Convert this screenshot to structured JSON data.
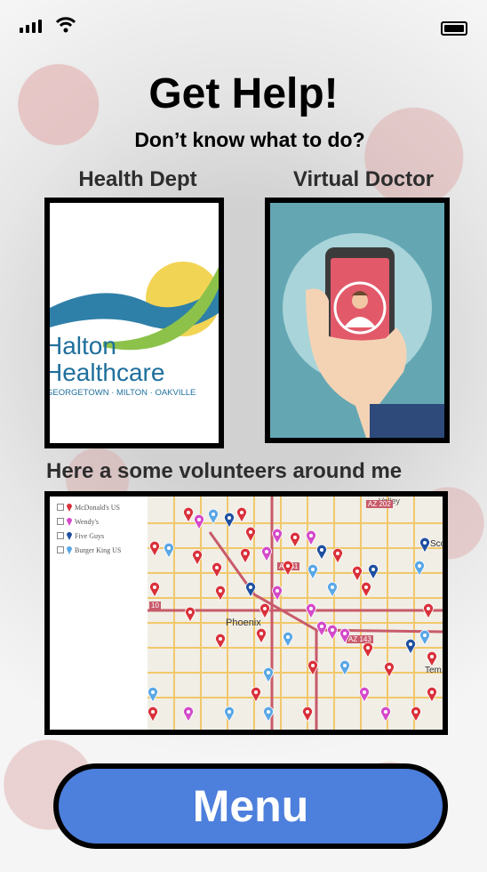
{
  "status_bar": {
    "signal_icon": "signal-bars-icon",
    "wifi_icon": "wifi-icon",
    "battery_icon": "battery-icon"
  },
  "header": {
    "title": "Get Help!",
    "subtitle": "Don’t know what to do?"
  },
  "cards": {
    "health_dept": {
      "label": "Health Dept",
      "logo_line1": "Halton",
      "logo_line2": "Healthcare",
      "logo_line3": "GEORGETOWN · MILTON · OAKVILLE"
    },
    "virtual_doctor": {
      "label": "Virtual Doctor",
      "icon": "phone-doctor-icon"
    }
  },
  "volunteers": {
    "label": "Here a some volunteers around me",
    "map": {
      "legend": [
        {
          "label": "McDonald's US",
          "color": "#d9313b"
        },
        {
          "label": "Wendy's",
          "color": "#d44ac9"
        },
        {
          "label": "Five Guys",
          "color": "#1f4fa0"
        },
        {
          "label": "Burger King US",
          "color": "#5aa7e6"
        }
      ],
      "place_labels": [
        "Phoenix",
        "Valley",
        "Tem",
        "Sco"
      ],
      "highway_labels": [
        "AZ 51",
        "10",
        "AZ 143",
        "AZ 202"
      ]
    }
  },
  "menu": {
    "label": "Menu"
  },
  "colors": {
    "menu_button": "#4d7fdc",
    "card_border": "#000000"
  }
}
